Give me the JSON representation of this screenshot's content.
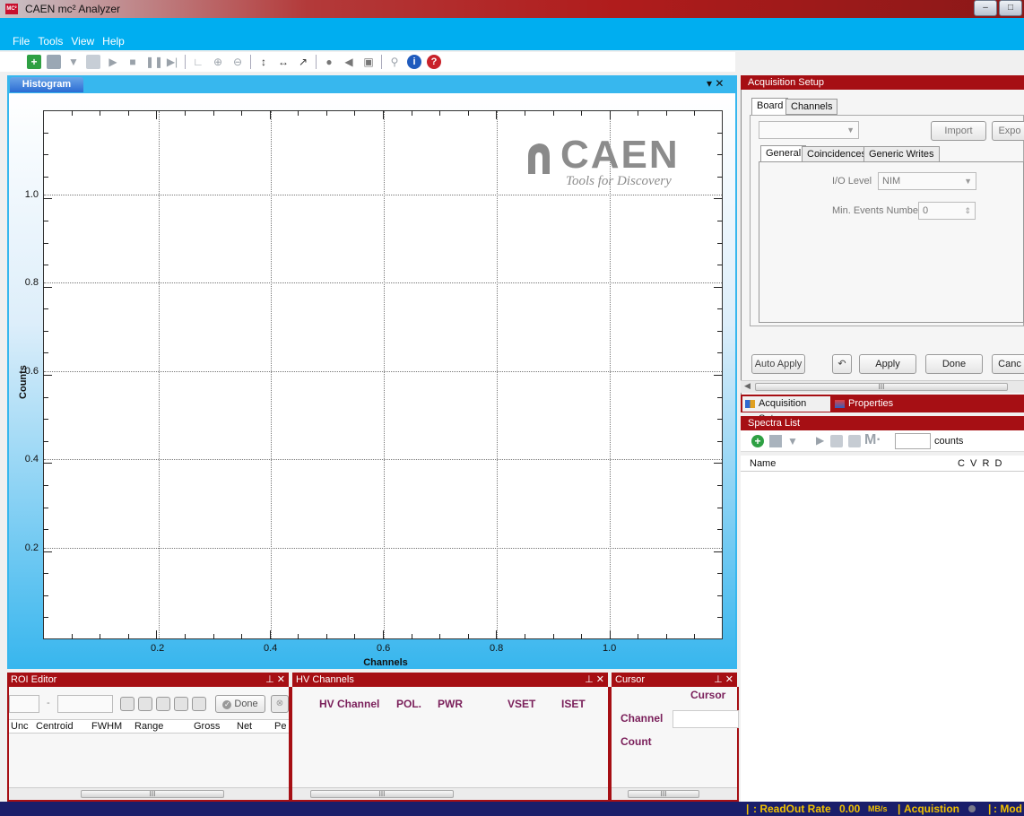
{
  "window": {
    "title": "CAEN mc² Analyzer",
    "app_icon": "MC²",
    "controls": [
      "minimize",
      "maximize"
    ]
  },
  "menu": [
    "File",
    "Tools",
    "View",
    "Help"
  ],
  "toolbar": {
    "icons": [
      "add-icon",
      "save-icon",
      "probe-icon",
      "rss-icon",
      "play-icon",
      "stop-icon",
      "pause-icon",
      "step-icon",
      "fit-icon",
      "zoom-in-icon",
      "zoom-out-icon",
      "vertical-arrows-icon",
      "horizontal-arrows-icon",
      "diagonal-icon",
      "color-icon",
      "back-icon",
      "chart-icon",
      "search-icon",
      "info-icon",
      "help-icon"
    ]
  },
  "histogram": {
    "tab_label": "Histogram",
    "panel_controls": "▾ ✕",
    "logo_brand": "CAEN",
    "logo_tagline": "Tools for Discovery"
  },
  "chart_data": {
    "type": "line",
    "title": "",
    "xlabel": "Channels",
    "ylabel": "Counts",
    "xlim": [
      0,
      1.2
    ],
    "ylim": [
      0,
      1.2
    ],
    "x_ticks": [
      "0.2",
      "0.4",
      "0.6",
      "0.8",
      "1.0"
    ],
    "y_ticks": [
      "0.2",
      "0.4",
      "0.6",
      "0.8",
      "1.0"
    ],
    "series": [],
    "grid": true
  },
  "acq_setup": {
    "header": "Acquisition Setup",
    "tabs": [
      "Board",
      "Channels"
    ],
    "import_label": "Import",
    "export_label": "Expo",
    "sub_tabs": [
      "General",
      "Coincidences",
      "Generic Writes"
    ],
    "io_level_label": "I/O Level",
    "io_level_value": "NIM",
    "min_events_label": "Min. Events Number",
    "min_events_value": "0",
    "auto_apply": "Auto Apply",
    "apply": "Apply",
    "done": "Done",
    "cancel": "Canc",
    "scroll_grip": "III"
  },
  "dock_tabs": {
    "acq": "Acquisition Setup",
    "props": "Properties"
  },
  "spectra": {
    "header": "Spectra List",
    "counts_label": "counts",
    "m_label": "M·",
    "col_name": "Name",
    "col_flags": "C  V  R  D"
  },
  "roi": {
    "header": "ROI Editor",
    "ctl": "⊥ ✕",
    "dash": "-",
    "done": "Done",
    "cols": [
      "Unc",
      "Centroid",
      "FWHM",
      "Range",
      "Gross",
      "Net",
      "Pe"
    ],
    "scroll_grip": "III"
  },
  "hv": {
    "header": "HV Channels",
    "ctl": "⊥ ✕",
    "cols": [
      "HV Channel",
      "POL.",
      "PWR",
      "VSET",
      "ISET"
    ],
    "scroll_grip": "III"
  },
  "cursor": {
    "header": "Cursor",
    "ctl": "⊥ ✕",
    "title": "Cursor",
    "channel_label": "Channel",
    "count_label": "Count",
    "scroll_grip": "III"
  },
  "status": {
    "sep": "|",
    "readout_label": ": ReadOut Rate",
    "readout_value": "0.00",
    "readout_unit": "MB/s",
    "acq_label": "Acquistion",
    "mode_label": ": Mod"
  },
  "colors": {
    "accent_blue": "#00aef0",
    "panel_red": "#a60f14",
    "status_bg": "#1a1e6a",
    "status_fg": "#f0c000"
  }
}
